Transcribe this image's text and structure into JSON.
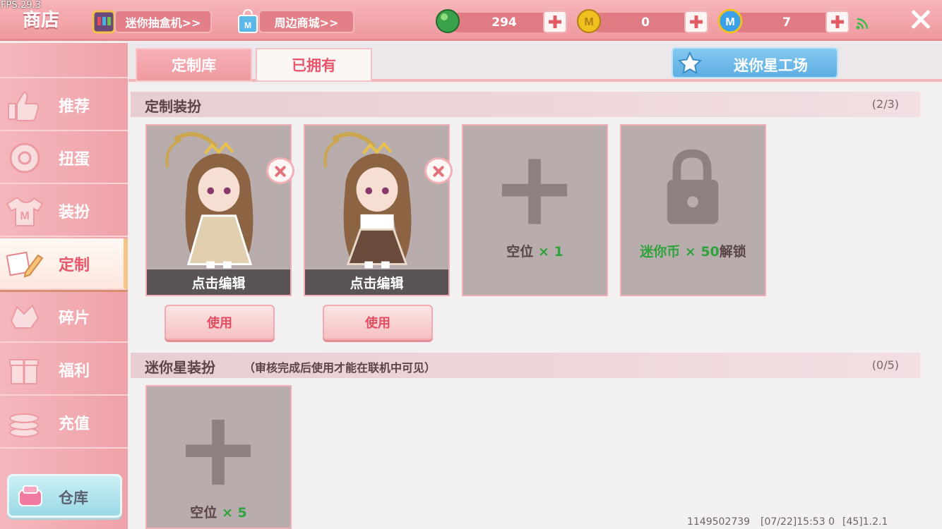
{
  "fps": "FPS:29.3",
  "header": {
    "title": "商店",
    "blindbox_label": "迷你抽盒机>>",
    "mall_label": "周边商城>>",
    "resources": [
      {
        "name": "green-bean",
        "value": "294",
        "color": "#3aa24a"
      },
      {
        "name": "mini-coin",
        "value": "0",
        "color": "#f0c020"
      },
      {
        "name": "mini-point",
        "value": "7",
        "color": "#3aa0e8"
      }
    ]
  },
  "sidebar": {
    "items": [
      {
        "label": "推荐"
      },
      {
        "label": "扭蛋"
      },
      {
        "label": "装扮"
      },
      {
        "label": "定制"
      },
      {
        "label": "碎片"
      },
      {
        "label": "福利"
      },
      {
        "label": "充值"
      }
    ],
    "active": "定制",
    "warehouse": "仓库"
  },
  "tabs": [
    {
      "label": "定制库"
    },
    {
      "label": "已拥有"
    }
  ],
  "star_factory": "迷你星工场",
  "section1": {
    "title": "定制装扮",
    "count": "(2/3)",
    "edit_label": "点击编辑",
    "use_label": "使用",
    "slot_text": "空位",
    "slot_count": "× 1",
    "unlock_cost": "迷你币 × 50",
    "unlock_word": "解锁"
  },
  "section2": {
    "title": "迷你星装扮",
    "subtitle": "（审核完成后使用才能在联机中可见）",
    "count": "(0/5)",
    "slot_text": "空位",
    "slot_count": "× 5"
  },
  "footer": {
    "uid": "1149502739",
    "time": "[07/22]15:53 0",
    "version": "[45]1.2.1"
  },
  "colors": {
    "accent": "#ef9aa1",
    "active_text": "#e7566a",
    "green": "#2ea33d"
  }
}
